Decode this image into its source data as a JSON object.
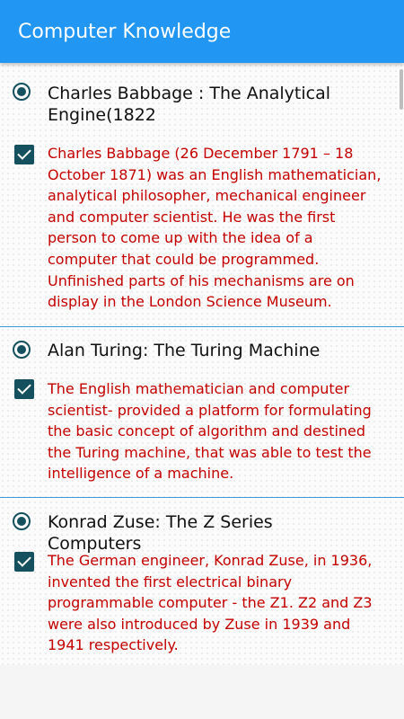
{
  "app": {
    "title": "Computer Knowledge"
  },
  "items": [
    {
      "title": "Charles Babbage : The Analytical Engine(1822",
      "description": "Charles Babbage (26 December 1791 – 18 October 1871) was an English mathematician, analytical philosopher, mechanical engineer and computer scientist. He was the first person to come up with the idea of a computer that could be programmed. Unfinished parts of his mechanisms are on display in the London Science Museum."
    },
    {
      "title": "Alan Turing: The Turing Machine",
      "description": "The English mathematician and computer scientist- provided a platform for formulating the basic concept of algorithm and destined the Turing machine, that was able to test the intelligence of a machine."
    },
    {
      "title": "Konrad Zuse: The Z Series Computers",
      "description": "The German engineer, Konrad Zuse, in 1936, invented the first electrical binary programmable computer - the Z1. Z2 and Z3 were also introduced by Zuse in 1939 and 1941 respectively."
    }
  ],
  "colors": {
    "appbar": "#2196f3",
    "accent": "#14505e",
    "description_text": "#c40000",
    "divider": "#3b9ad6"
  }
}
